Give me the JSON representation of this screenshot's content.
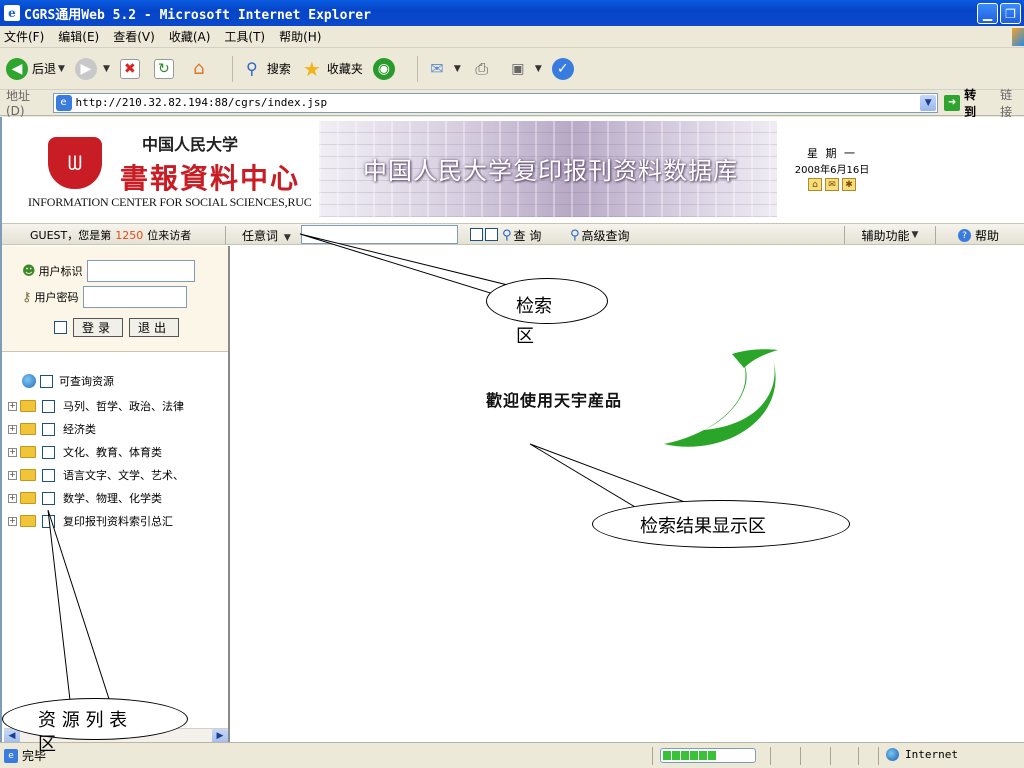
{
  "window": {
    "title": "CGRS通用Web 5.2 - Microsoft Internet Explorer",
    "app_icon": "e"
  },
  "menu": {
    "items": [
      "文件(F)",
      "编辑(E)",
      "查看(V)",
      "收藏(A)",
      "工具(T)",
      "帮助(H)"
    ]
  },
  "toolbar": {
    "back_label": "后退",
    "search_label": "搜索",
    "favorites_label": "收藏夹"
  },
  "address": {
    "label": "地址(D)",
    "url": "http://210.32.82.194:88/cgrs/index.jsp",
    "go_label": "转到",
    "links_label": "链接"
  },
  "banner": {
    "logo_mark": "ᗯ",
    "logo_cn": "中国人民大学",
    "logo_calligraphy": "書報資料中心",
    "logo_en": "INFORMATION CENTER FOR SOCIAL SCIENCES,RUC",
    "title": "中国人民大学复印报刊资料数据库",
    "weekday": "星 期 一",
    "date": "2008年6月16日"
  },
  "navbar": {
    "guest_prefix": "GUEST，您是第",
    "visitor_count": "1250",
    "guest_suffix": "位来访者",
    "keyword_select": "任意词",
    "search_label": "查 询",
    "advanced_label": "高级查询",
    "aux_label": "辅助功能",
    "help_label": "帮助"
  },
  "login": {
    "user_label": "用户标识",
    "password_label": "用户密码",
    "login_button": "登录",
    "logout_button": "退出"
  },
  "tree": {
    "root_label": "可查询资源",
    "items": [
      {
        "label": "马列、哲学、政治、法律"
      },
      {
        "label": "经济类"
      },
      {
        "label": "文化、教育、体育类"
      },
      {
        "label": "语言文字、文学、艺术、"
      },
      {
        "label": "数学、物理、化学类"
      },
      {
        "label": "复印报刊资料索引总汇"
      }
    ]
  },
  "main": {
    "welcome": "歡迎使用天宇産品"
  },
  "callouts": {
    "search_area_line1": "检索",
    "search_area_line2": "区",
    "results_area": "检索结果显示区",
    "resource_list_line1": "资 源 列 表",
    "resource_list_line2": "区"
  },
  "status": {
    "text": "完毕",
    "zone": "Internet",
    "progress_blocks": 6
  },
  "colors": {
    "titlebar": "#0a5be0",
    "visitor_count": "#e24a1a",
    "swoosh": "#2aa52a",
    "logo_red": "#c81d24"
  }
}
